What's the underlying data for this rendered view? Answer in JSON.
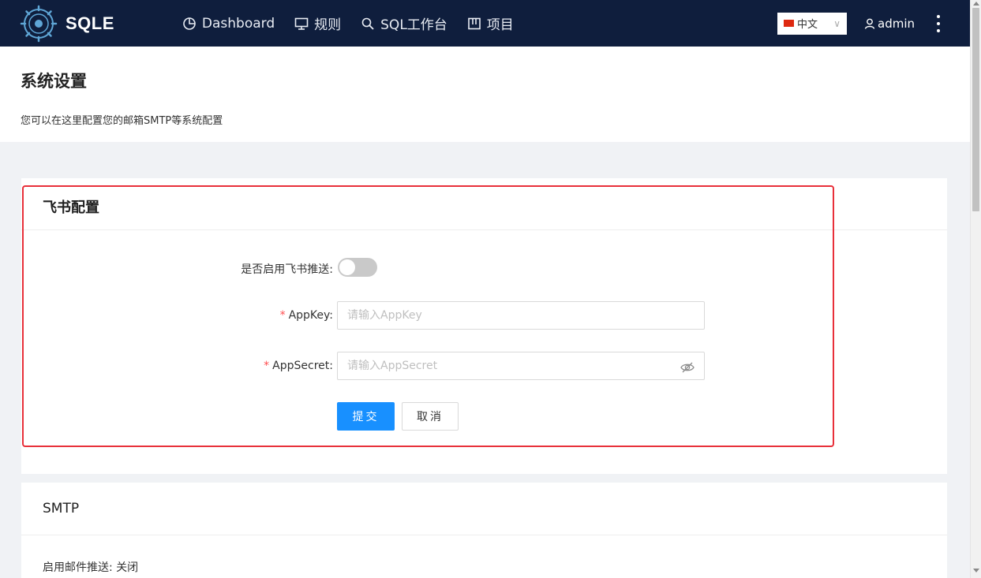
{
  "header": {
    "logo_text": "SQLE",
    "nav": [
      {
        "label": "Dashboard",
        "icon": "dashboard-icon"
      },
      {
        "label": "规则",
        "icon": "monitor-icon"
      },
      {
        "label": "SQL工作台",
        "icon": "search-icon"
      },
      {
        "label": "项目",
        "icon": "project-icon"
      }
    ],
    "language": "中文",
    "user": "admin"
  },
  "page": {
    "title": "系统设置",
    "description": "您可以在这里配置您的邮箱SMTP等系统配置"
  },
  "feishu": {
    "title": "飞书配置",
    "enable_label": "是否启用飞书推送:",
    "enabled": false,
    "app_key_label": "AppKey:",
    "app_key_placeholder": "请输入AppKey",
    "app_secret_label": "AppSecret:",
    "app_secret_placeholder": "请输入AppSecret",
    "required_mark": "*",
    "submit_label": "提交",
    "cancel_label": "取消"
  },
  "smtp": {
    "title": "SMTP",
    "status_text": "启用邮件推送: 关闭"
  },
  "colors": {
    "header_bg": "#0f1e3d",
    "primary": "#1890ff",
    "highlight_border": "#e8303a"
  }
}
